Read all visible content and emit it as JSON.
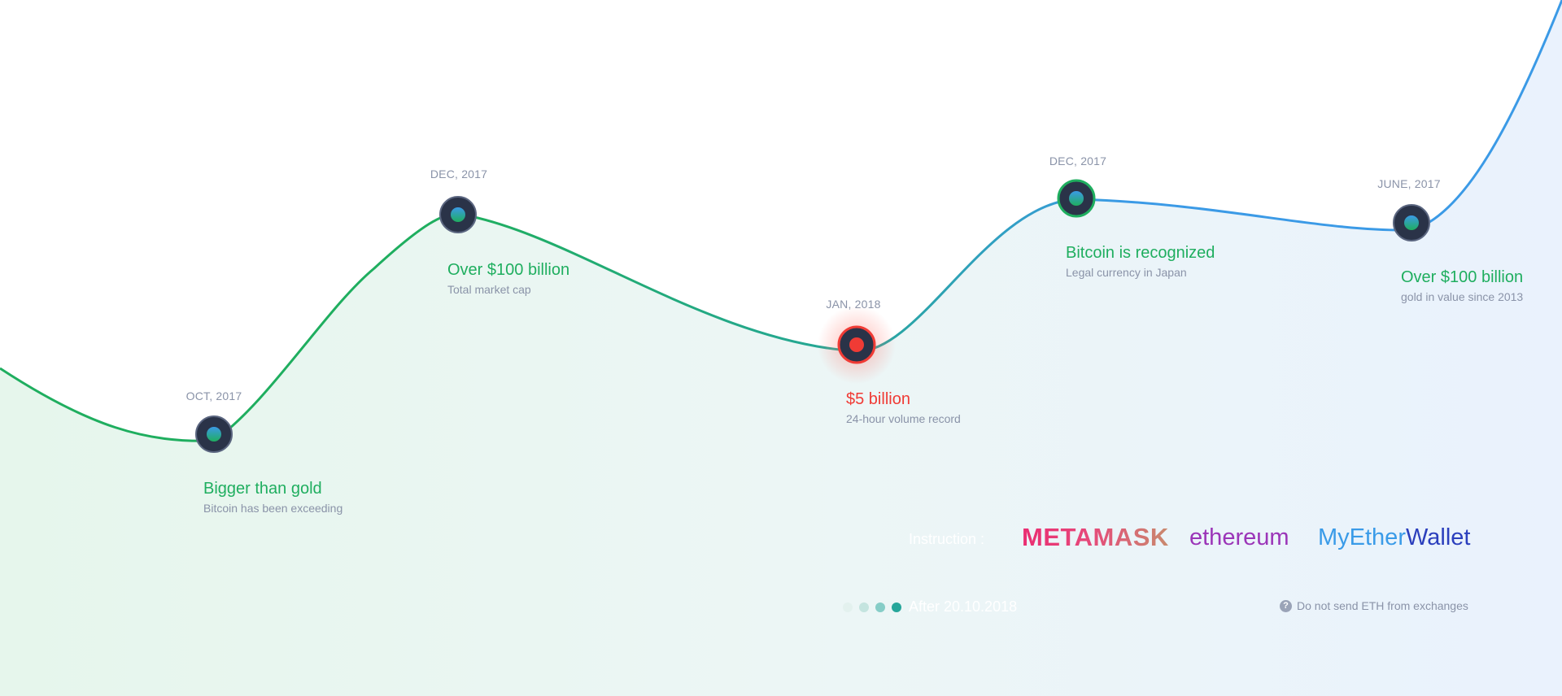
{
  "milestones": [
    {
      "date": "OCT, 2017",
      "title": "Bigger than gold",
      "subtitle": "Bitcoin has been exceeding",
      "status": "normal"
    },
    {
      "date": "DEC, 2017",
      "title": "Over $100 billion",
      "subtitle": "Total market cap",
      "status": "normal"
    },
    {
      "date": "JAN, 2018",
      "title": "$5 billion",
      "subtitle": "24-hour volume record",
      "status": "alert"
    },
    {
      "date": "DEC, 2017",
      "title": "Bitcoin is recognized",
      "subtitle": "Legal currency in Japan",
      "status": "active"
    },
    {
      "date": "JUNE, 2017",
      "title": "Over $100 billion",
      "subtitle": "gold in value since 2013",
      "status": "normal"
    }
  ],
  "instruction": {
    "label": "Instruction :",
    "logos": [
      {
        "name": "metamask",
        "text": "METAMASK"
      },
      {
        "name": "ethereum",
        "text": "ethereum"
      },
      {
        "name": "myetherwallet",
        "text_a": "MyEther",
        "text_b": "Wallet"
      }
    ]
  },
  "footer": {
    "after_text": "After 20.10.2018",
    "notice_icon": "question-icon",
    "notice_text": "Do not send ETH from exchanges",
    "step_dots": 4
  },
  "colors": {
    "green": "#1fae5f",
    "teal": "#26a69a",
    "blue": "#3b9ae6",
    "red": "#f03b35",
    "node_dark": "#2a3348",
    "muted": "#8a93a8"
  }
}
